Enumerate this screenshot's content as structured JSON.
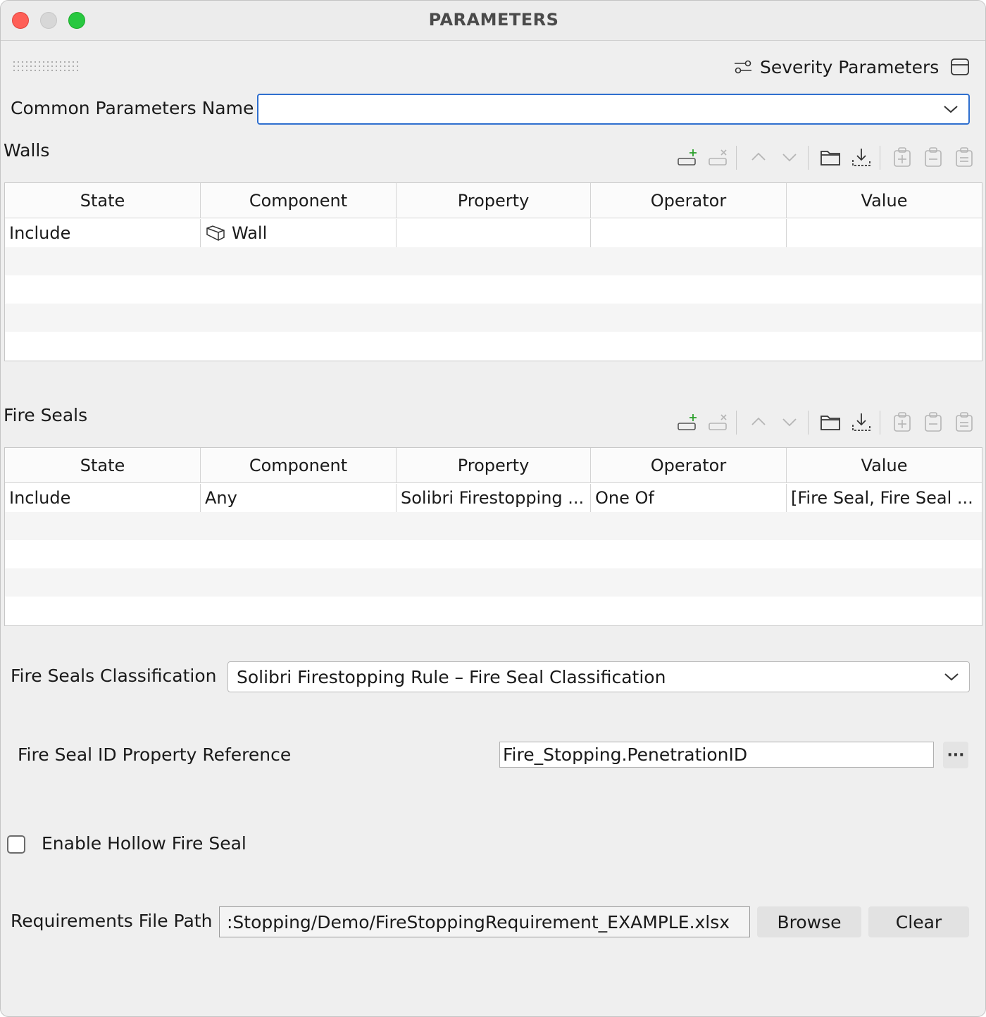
{
  "window": {
    "title": "PARAMETERS"
  },
  "header": {
    "severity_label": "Severity Parameters"
  },
  "common_params": {
    "label": "Common Parameters Name",
    "value": ""
  },
  "walls": {
    "title": "Walls",
    "columns": [
      "State",
      "Component",
      "Property",
      "Operator",
      "Value"
    ],
    "rows": [
      {
        "state": "Include",
        "component": "Wall",
        "property": "",
        "operator": "",
        "value": ""
      }
    ]
  },
  "fire_seals": {
    "title": "Fire Seals",
    "columns": [
      "State",
      "Component",
      "Property",
      "Operator",
      "Value"
    ],
    "rows": [
      {
        "state": "Include",
        "component": "Any",
        "property": "Solibri Firestopping ...",
        "operator": "One Of",
        "value": "[Fire Seal, Fire Seal ..."
      }
    ]
  },
  "classification": {
    "label": "Fire Seals Classification",
    "value": "Solibri Firestopping Rule – Fire Seal Classification"
  },
  "seal_id": {
    "label": "Fire Seal ID Property Reference",
    "value": "Fire_Stopping.PenetrationID",
    "dots": "···"
  },
  "hollow": {
    "label": "Enable Hollow Fire Seal",
    "checked": false
  },
  "requirements": {
    "label": "Requirements File Path",
    "value": ":Stopping/Demo/FireStoppingRequirement_EXAMPLE.xlsx",
    "browse": "Browse",
    "clear": "Clear"
  },
  "icons": [
    "add-row-icon",
    "remove-row-icon",
    "move-up-icon",
    "move-down-icon",
    "open-folder-icon",
    "import-icon",
    "new-clipboard-icon",
    "remove-clipboard-icon",
    "clipboard-icon",
    "sliders-icon",
    "panel-icon",
    "chevron-down-icon",
    "wall-icon"
  ],
  "colors": {
    "focus_border": "#2f6fcf",
    "add_green": "#2ca02c"
  }
}
